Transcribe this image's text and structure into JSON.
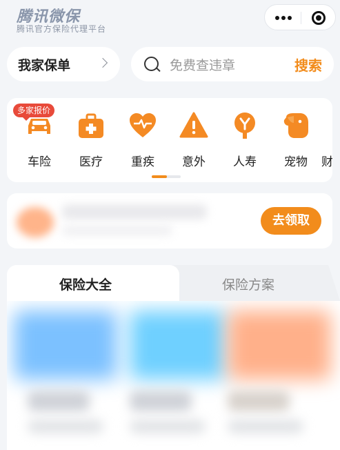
{
  "header": {
    "brand": "腾讯微保",
    "subtitle": "腾讯官方保险代理平台"
  },
  "top_bar": {
    "policy_label": "我家保单",
    "search_placeholder": "免费查违章",
    "search_button": "搜索"
  },
  "categories": [
    {
      "label": "车险",
      "icon": "car-icon"
    },
    {
      "label": "医疗",
      "icon": "medical-kit-icon"
    },
    {
      "label": "重疾",
      "icon": "heart-pulse-icon"
    },
    {
      "label": "意外",
      "icon": "warning-icon"
    },
    {
      "label": "人寿",
      "icon": "tree-icon"
    },
    {
      "label": "宠物",
      "icon": "dog-icon"
    },
    {
      "label": "财"
    }
  ],
  "badge": "多家报价",
  "promo": {
    "button": "去领取"
  },
  "tabs": [
    {
      "label": "保险大全",
      "active": true
    },
    {
      "label": "保险方案",
      "active": false
    }
  ],
  "colors": {
    "accent": "#f28c1c",
    "badge": "#e84a3a",
    "background": "#f3f5f8"
  }
}
